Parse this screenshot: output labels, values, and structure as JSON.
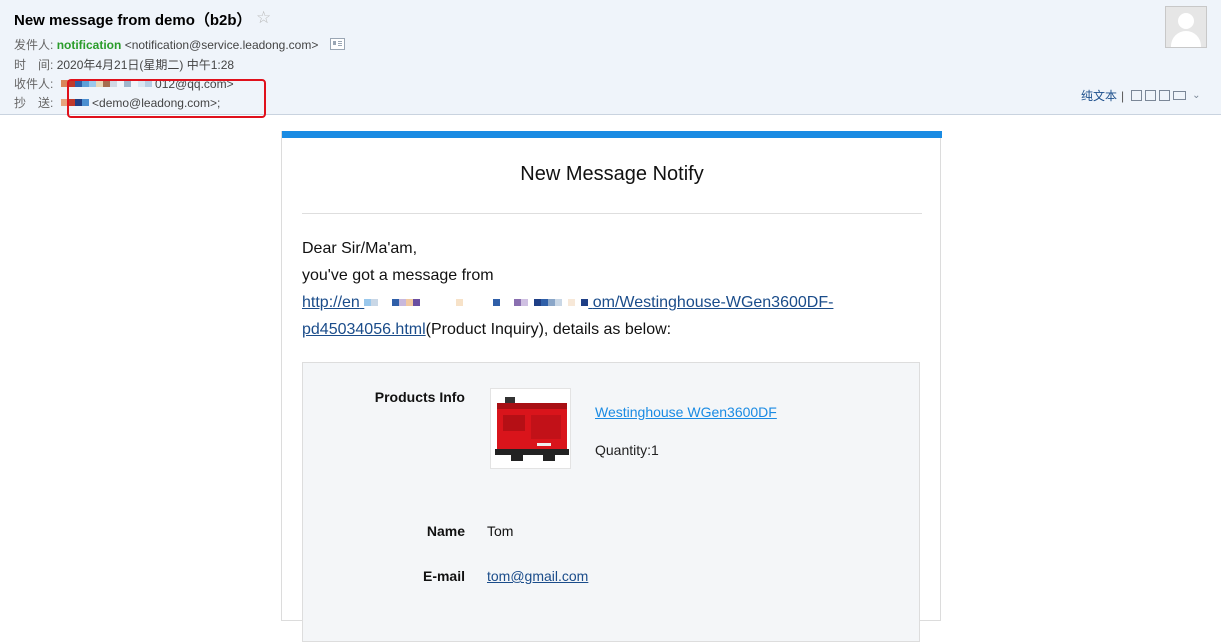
{
  "header": {
    "subject": "New message from demo（b2b）",
    "sender_label": "发件人:",
    "sender_name": "notification",
    "sender_email": "<notification@service.leadong.com>",
    "time_label": "时　间:",
    "time_value": "2020年4月21日(星期二) 中午1:28",
    "recipient_label": "收件人:",
    "recipient_value": "012@qq.com>",
    "cc_label": "抄　送:",
    "cc_value": "<demo@leadong.com>;",
    "plain_text_label": "纯文本",
    "separator": "|"
  },
  "icons": [
    "star-icon",
    "contact-card-icon",
    "avatar-icon",
    "new-window-icon",
    "note-icon",
    "reader-icon",
    "print-icon",
    "chevron-down-icon"
  ],
  "colors": {
    "sender_name": "#2a9c2a",
    "accent_bar": "#1a8be3",
    "highlight_box": "#e0101b",
    "link": "#1a4c8a"
  },
  "body": {
    "title": "New Message Notify",
    "greeting": "Dear Sir/Ma'am,",
    "intro": "you've got a message from",
    "link_start": "http://en",
    "link_mid": "om/Westinghouse-WGen3600DF-",
    "link_end": "pd45034056.html",
    "after_link": "(Product Inquiry), details as below:",
    "info": {
      "products_label": "Products Info",
      "product_name": "Westinghouse WGen3600DF",
      "quantity": "Quantity:1",
      "name_label": "Name",
      "name_value": "Tom",
      "email_label": "E-mail",
      "email_value": "tom@gmail.com"
    }
  }
}
